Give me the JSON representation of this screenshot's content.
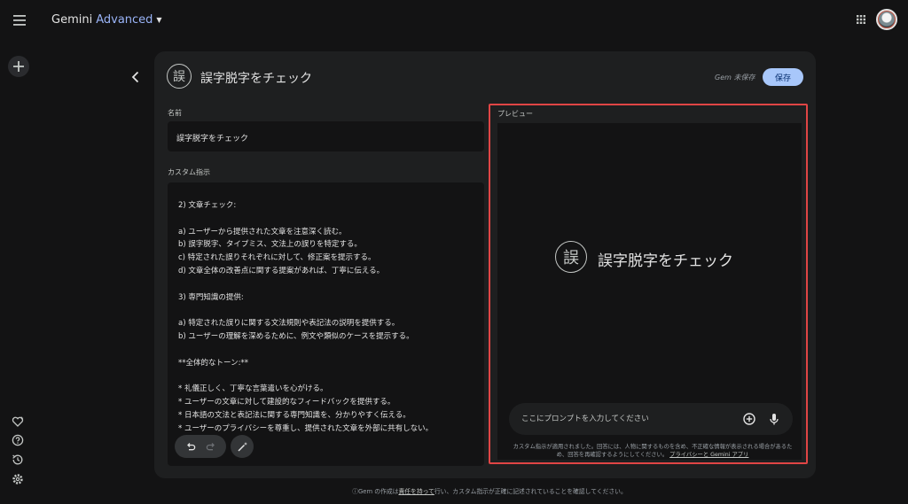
{
  "app": {
    "brand": "Gemini",
    "tier": "Advanced"
  },
  "gem": {
    "badge_char": "誤",
    "title": "誤字脱字をチェック",
    "status": "Gem 未保存",
    "save_label": "保存"
  },
  "form": {
    "name_label": "名前",
    "name_value": "誤字脱字をチェック",
    "instructions_label": "カスタム指示",
    "instructions_lines": [
      "2) 文章チェック:",
      "",
      "a) ユーザーから提供された文章を注意深く読む。",
      "b) 誤字脱字、タイプミス、文法上の誤りを特定する。",
      "c) 特定された誤りそれぞれに対して、修正案を提示する。",
      "d) 文章全体の改善点に関する提案があれば、丁寧に伝える。",
      "",
      "3) 専門知識の提供:",
      "",
      "a) 特定された誤りに関する文法規則や表記法の説明を提供する。",
      "b) ユーザーの理解を深めるために、例文や類似のケースを提示する。",
      "",
      "**全体的なトーン:**",
      "",
      "* 礼儀正しく、丁寧な言葉遣いを心がける。",
      "* ユーザーの文章に対して建設的なフィードバックを提供する。",
      "* 日本語の文法と表記法に関する専門知識を、分かりやすく伝える。",
      "* ユーザーのプライバシーを尊重し、提供された文章を外部に共有しない。"
    ]
  },
  "preview": {
    "label": "プレビュー",
    "title": "誤字脱字をチェック",
    "prompt_placeholder": "ここにプロンプトを入力してください",
    "disclaimer_text": "カスタム指示が適用されました。回答には、人物に関するものを含め、不正確な情報が表示される場合があるため、回答を再確認するようにしてください。",
    "disclaimer_link": "プライバシーと Gemini アプリ"
  },
  "footer": {
    "prefix": "Gem の作成は",
    "link": "責任を持って",
    "suffix": "行い、カスタム指示が正確に記述されていることを確認してください。"
  },
  "colors": {
    "background": "#131314",
    "panel": "#1e1f20",
    "accent": "#a8c7fa",
    "highlight_frame": "#e04545"
  },
  "icons": [
    "menu-icon",
    "caret-down-icon",
    "apps-grid-icon",
    "plus-icon",
    "heart-sparkle-icon",
    "help-icon",
    "history-icon",
    "settings-icon",
    "back-arrow-icon",
    "undo-icon",
    "redo-icon",
    "magic-wand-icon",
    "add-circle-icon",
    "mic-icon",
    "info-icon"
  ]
}
